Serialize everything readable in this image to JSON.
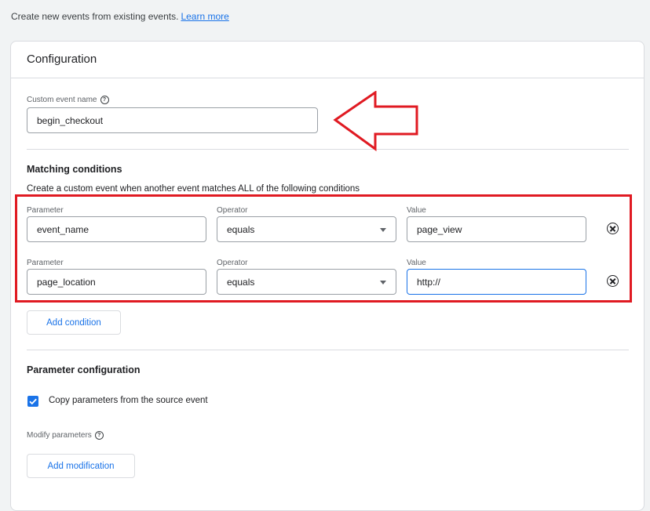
{
  "intro": {
    "text": "Create new events from existing events.",
    "link": "Learn more"
  },
  "config": {
    "title": "Configuration",
    "custom_event_label": "Custom event name",
    "custom_event_value": "begin_checkout"
  },
  "matching": {
    "title": "Matching conditions",
    "description": "Create a custom event when another event matches ALL of the following conditions",
    "rows": [
      {
        "param_label": "Parameter",
        "param_value": "event_name",
        "op_label": "Operator",
        "op_value": "equals",
        "value_label": "Value",
        "value_value": "page_view"
      },
      {
        "param_label": "Parameter",
        "param_value": "page_location",
        "op_label": "Operator",
        "op_value": "equals",
        "value_label": "Value",
        "value_value": "http://"
      }
    ],
    "add_condition": "Add condition"
  },
  "param_config": {
    "title": "Parameter configuration",
    "copy_label": "Copy parameters from the source event",
    "copy_checked": true,
    "modify_label": "Modify parameters",
    "add_modification": "Add modification"
  },
  "colors": {
    "accent": "#1a73e8",
    "annotation": "#e01a22"
  },
  "icons": {
    "help": "help-circle-icon",
    "remove": "remove-circle-icon",
    "dropdown": "dropdown-caret-icon",
    "check": "checkmark-icon"
  }
}
